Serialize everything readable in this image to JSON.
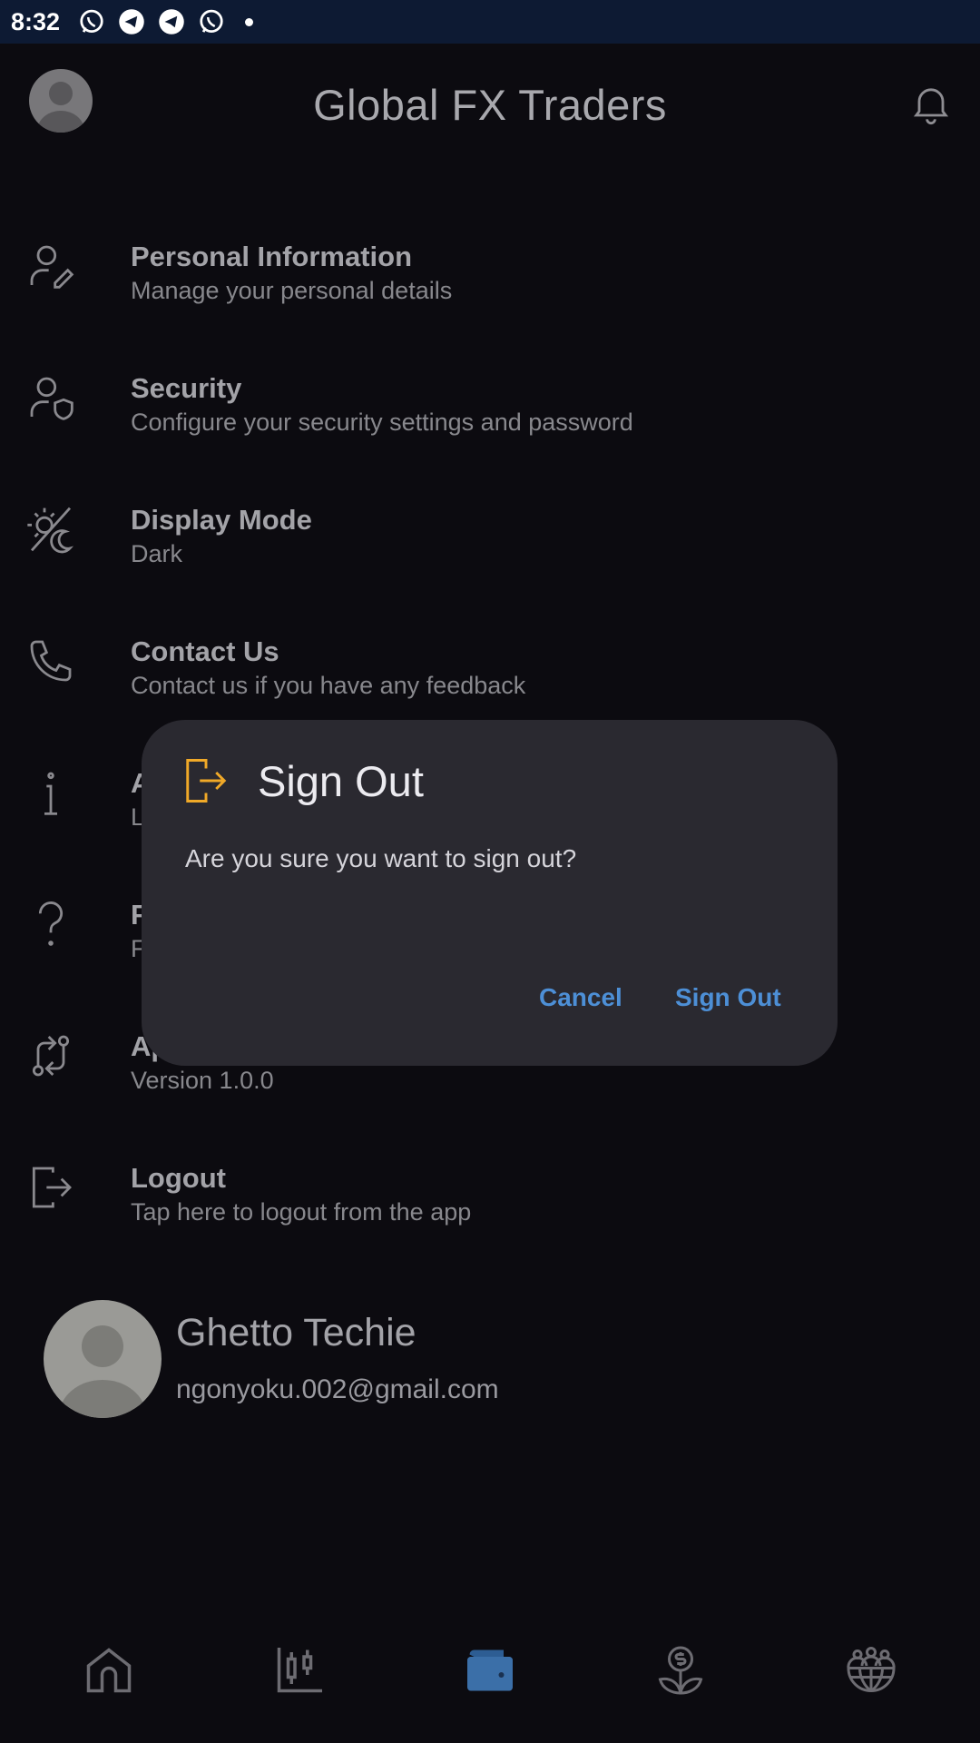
{
  "status_bar": {
    "time": "8:32",
    "notification_icons": [
      "whatsapp-icon",
      "telegram-icon",
      "telegram-icon",
      "whatsapp-icon"
    ]
  },
  "header": {
    "title": "Global FX Traders"
  },
  "menu": {
    "items": [
      {
        "icon": "user-edit-icon",
        "title": "Personal Information",
        "subtitle": "Manage your personal details"
      },
      {
        "icon": "user-shield-icon",
        "title": "Security",
        "subtitle": "Configure your security settings and password"
      },
      {
        "icon": "sun-moon-icon",
        "title": "Display Mode",
        "subtitle": "Dark"
      },
      {
        "icon": "phone-icon",
        "title": "Contact Us",
        "subtitle": "Contact us if you have any feedback"
      },
      {
        "icon": "info-icon",
        "title": "A",
        "subtitle": "L"
      },
      {
        "icon": "help-icon",
        "title": "F",
        "subtitle": "F"
      },
      {
        "icon": "git-compare-icon",
        "title": "Ap",
        "subtitle": "Version 1.0.0"
      },
      {
        "icon": "logout-icon",
        "title": "Logout",
        "subtitle": "Tap here to logout from the app"
      }
    ]
  },
  "profile": {
    "name": "Ghetto Techie",
    "email": "ngonyoku.002@gmail.com"
  },
  "bottom_nav": {
    "items": [
      "home-icon",
      "candlestick-chart-icon",
      "wallet-icon",
      "plant-dollar-icon",
      "community-globe-icon"
    ],
    "active": "wallet-icon"
  },
  "dialog": {
    "title": "Sign Out",
    "message": "Are you sure you want to sign out?",
    "cancel_label": "Cancel",
    "confirm_label": "Sign Out",
    "icon": "sign-out-icon"
  },
  "colors": {
    "background": "#0c0b10",
    "status_bar": "#0d1a33",
    "dialog_bg": "#2a2930",
    "accent_blue": "#4d8fd6",
    "dialog_icon": "#f0a928"
  }
}
